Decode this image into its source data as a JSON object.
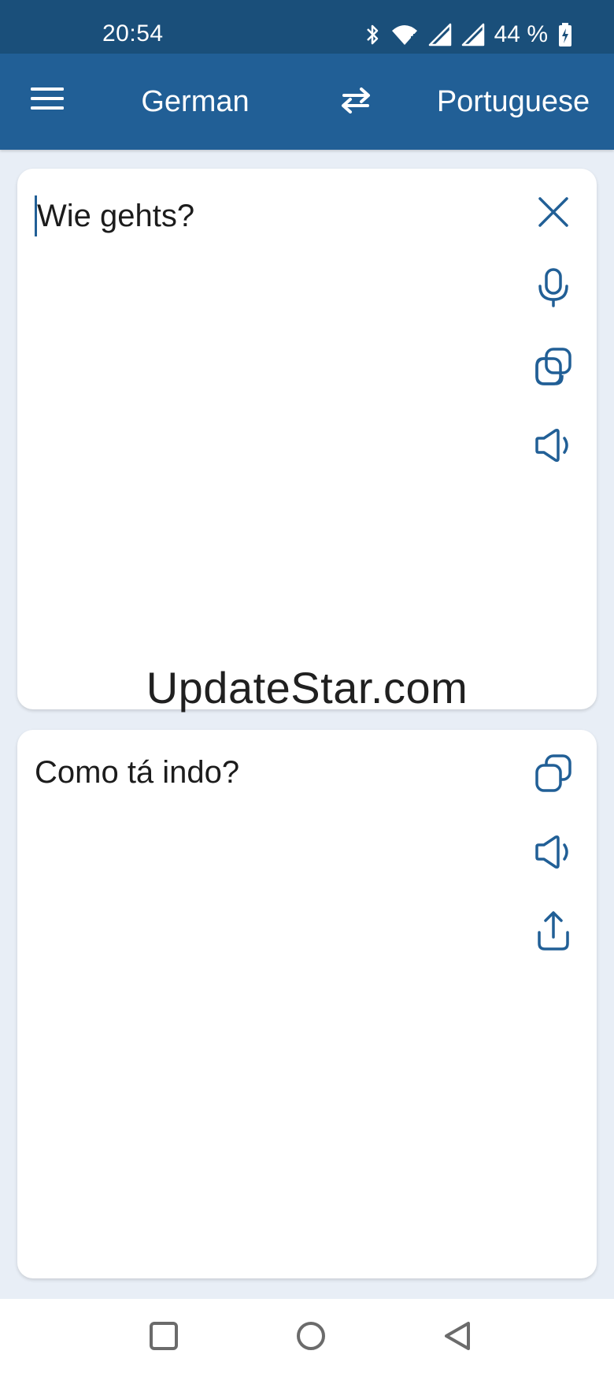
{
  "status_bar": {
    "time": "20:54",
    "battery_text": "44 %",
    "icons": [
      "bluetooth-icon",
      "wifi-icon",
      "signal-icon",
      "signal-icon",
      "battery-charging-icon"
    ]
  },
  "app_bar": {
    "source_language": "German",
    "target_language": "Portuguese",
    "icons": [
      "menu-icon",
      "swap-arrows-icon"
    ]
  },
  "source_card": {
    "text": "Wie gehts?",
    "icons": [
      "close-icon",
      "microphone-icon",
      "copy-icon",
      "speaker-icon"
    ]
  },
  "target_card": {
    "text": "Como tá indo?",
    "icons": [
      "copy-icon",
      "speaker-icon",
      "share-icon"
    ]
  },
  "watermark": {
    "text": "UpdateStar.com"
  },
  "nav_bar": {
    "icons": [
      "recents-square-icon",
      "home-circle-icon",
      "back-triangle-icon"
    ]
  },
  "colors": {
    "status_bar": "#1a4f7a",
    "app_bar": "#215f96",
    "icon_accent": "#215f96",
    "background": "#e8eef6",
    "card": "#ffffff"
  }
}
